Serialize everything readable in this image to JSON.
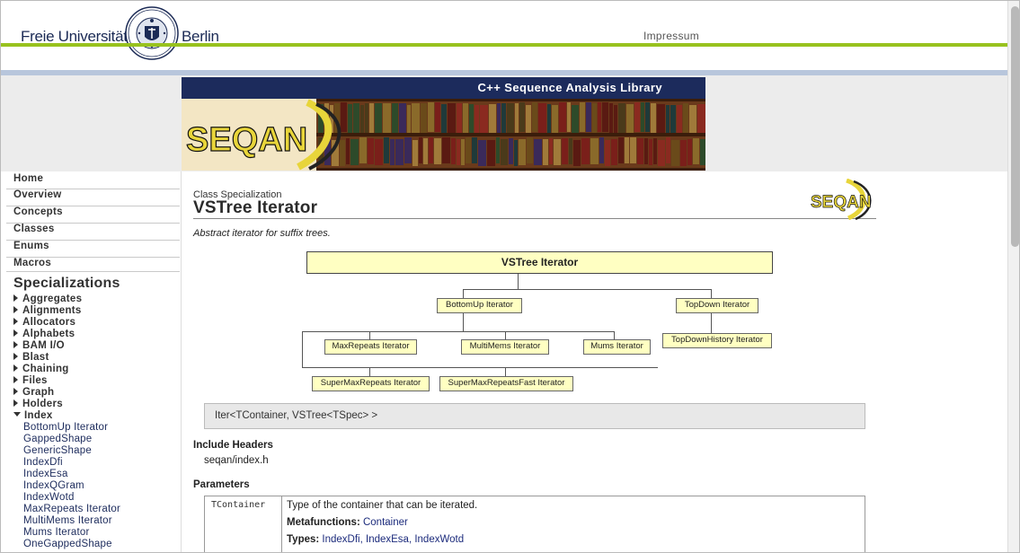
{
  "header": {
    "university_left": "Freie Universität",
    "university_right": "Berlin",
    "impressum": "Impressum",
    "colors": {
      "green": "#98c21e",
      "navy": "#1c2b5c",
      "band": "#b8c6dc"
    }
  },
  "banner": {
    "title": "C++ Sequence Analysis Library",
    "logo_text": "SEQAN"
  },
  "sidebar": {
    "nav": [
      {
        "label": "Home"
      },
      {
        "label": "Overview"
      },
      {
        "label": "Concepts"
      },
      {
        "label": "Classes"
      },
      {
        "label": "Enums"
      },
      {
        "label": "Macros"
      }
    ],
    "section_title": "Specializations",
    "categories": [
      {
        "label": "Aggregates"
      },
      {
        "label": "Alignments"
      },
      {
        "label": "Allocators"
      },
      {
        "label": "Alphabets"
      },
      {
        "label": "BAM I/O"
      },
      {
        "label": "Blast"
      },
      {
        "label": "Chaining"
      },
      {
        "label": "Files"
      },
      {
        "label": "Graph"
      },
      {
        "label": "Holders"
      },
      {
        "label": "Index"
      }
    ],
    "index_items": [
      {
        "label": "BottomUp Iterator"
      },
      {
        "label": "GappedShape"
      },
      {
        "label": "GenericShape"
      },
      {
        "label": "IndexDfi"
      },
      {
        "label": "IndexEsa"
      },
      {
        "label": "IndexQGram"
      },
      {
        "label": "IndexWotd"
      },
      {
        "label": "MaxRepeats Iterator"
      },
      {
        "label": "MultiMems Iterator"
      },
      {
        "label": "Mums Iterator"
      },
      {
        "label": "OneGappedShape"
      }
    ]
  },
  "main": {
    "kind": "Class Specialization",
    "title": "VSTree Iterator",
    "summary": "Abstract iterator for suffix trees.",
    "hierarchy": {
      "root": "VSTree Iterator",
      "bottomup": "BottomUp Iterator",
      "topdown": "TopDown Iterator",
      "maxrepeats": "MaxRepeats Iterator",
      "multimems": "MultiMems Iterator",
      "mums": "Mums Iterator",
      "topdownhistory": "TopDownHistory Iterator",
      "supermaxrepeats": "SuperMaxRepeats Iterator",
      "supermaxrepeatsfast": "SuperMaxRepeatsFast Iterator"
    },
    "signature": "Iter<TContainer, VSTree<TSpec> >",
    "include_title": "Include Headers",
    "include_value": "seqan/index.h",
    "params_title": "Parameters",
    "params": {
      "name": "TContainer",
      "description": "Type of the container that can be iterated.",
      "metafunctions_label": "Metafunctions:",
      "metafunction": "Container",
      "types_label": "Types:",
      "types": [
        "IndexDfi",
        "IndexEsa",
        "IndexWotd"
      ]
    }
  }
}
